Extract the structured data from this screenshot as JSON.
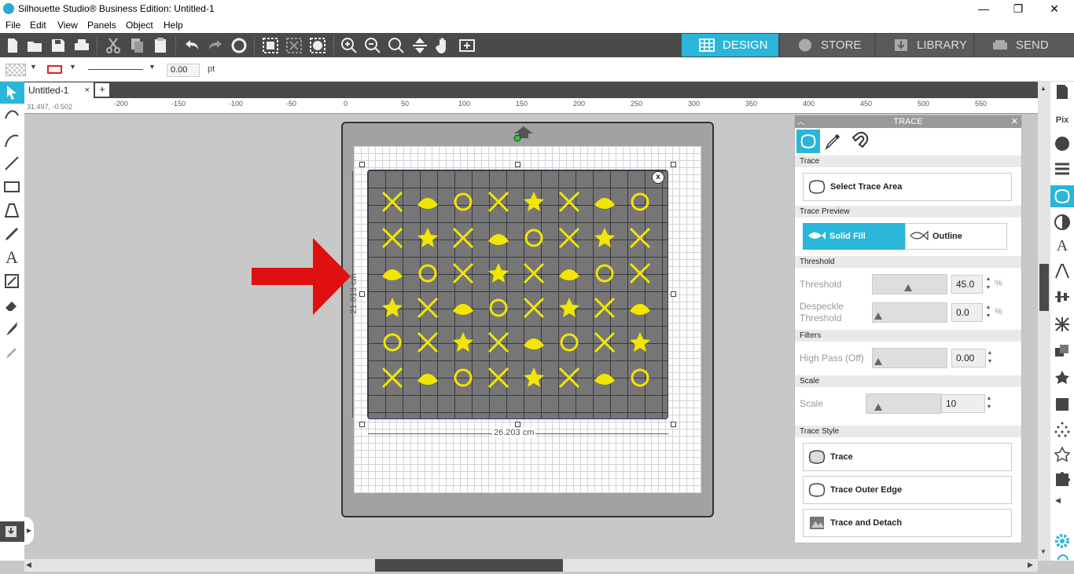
{
  "window": {
    "title": "Silhouette Studio® Business Edition: Untitled-1",
    "minimize": "—",
    "restore": "❐",
    "close": "✕"
  },
  "menu": [
    "File",
    "Edit",
    "View",
    "Panels",
    "Object",
    "Help"
  ],
  "nav_tabs": {
    "design": "DESIGN",
    "store": "STORE",
    "library": "LIBRARY",
    "send": "SEND",
    "active": "DESIGN"
  },
  "options_bar": {
    "line_width": "0.00",
    "unit": "pt"
  },
  "document": {
    "tab_name": "Untitled-1",
    "close": "×",
    "add": "+"
  },
  "ruler": {
    "labels": [
      "-200",
      "-150",
      "-100",
      "-50",
      "0",
      "50",
      "100",
      "150",
      "200",
      "250",
      "300",
      "350",
      "400",
      "450",
      "500",
      "550"
    ],
    "right_labels": [
      "0",
      "50",
      "100",
      "150",
      "200",
      "250"
    ],
    "coords": "31.497, -0.502"
  },
  "canvas": {
    "width_label": "26.203 cm",
    "height_label": "21.813 cm",
    "close_glyph": "x"
  },
  "trace_panel": {
    "title": "TRACE",
    "sections": {
      "trace": "Trace",
      "trace_preview": "Trace Preview",
      "threshold": "Threshold",
      "filters": "Filters",
      "scale": "Scale",
      "trace_style": "Trace Style"
    },
    "select_trace_area": "Select Trace Area",
    "preview": {
      "solid_fill": "Solid Fill",
      "outline": "Outline",
      "active": "Solid Fill"
    },
    "threshold": {
      "label": "Threshold",
      "value": "45.0",
      "unit": "%",
      "level": 0.45
    },
    "despeckle": {
      "label_line1": "Despeckle",
      "label_line2": "Threshold",
      "value": "0.0",
      "unit": "%",
      "level": 0
    },
    "high_pass": {
      "label": "High Pass (Off)",
      "value": "0.00",
      "level": 0
    },
    "scale": {
      "label": "Scale",
      "value": "10",
      "level": 0.1
    },
    "styles": {
      "trace": "Trace",
      "trace_outer_edge": "Trace Outer Edge",
      "trace_and_detach": "Trace and Detach"
    }
  },
  "colors": {
    "accent": "#29b6d8",
    "toolbar": "#4a4a4a",
    "icon_yellow": "#f2e600",
    "arrow_red": "#e01010"
  }
}
